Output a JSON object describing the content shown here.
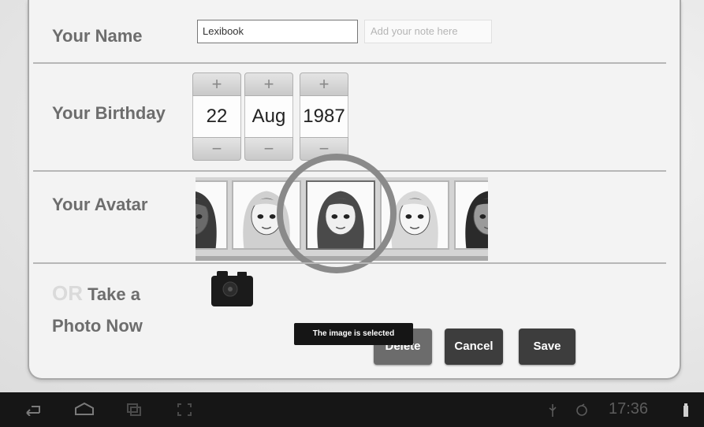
{
  "form": {
    "name_label": "Your Name",
    "name_value": "Lexibook",
    "note_placeholder": "Add your note here",
    "birthday_label": "Your Birthday",
    "birthday": {
      "day": "22",
      "month": "Aug",
      "year": "1987",
      "plus_glyph": "+",
      "minus_glyph": "−"
    },
    "avatar_label": "Your Avatar",
    "avatars": [
      {
        "name": "avatar-1",
        "hair": "#3a3a3a",
        "face": "#6a6a6a"
      },
      {
        "name": "avatar-2",
        "hair": "#d0d0d0",
        "face": "#f2f2f2"
      },
      {
        "name": "avatar-3",
        "hair": "#4a4a4a",
        "face": "#efefef"
      },
      {
        "name": "avatar-4",
        "hair": "#d8d8d8",
        "face": "#f6f6f6"
      },
      {
        "name": "avatar-5",
        "hair": "#2a2a2a",
        "face": "#9a9a9a"
      }
    ],
    "selected_avatar": 2,
    "photo_or": "OR",
    "photo_label_line1": "Take a",
    "photo_label_line2": "Photo Now",
    "camera_icon": "camera-icon"
  },
  "actions": {
    "delete_label": "Delete",
    "cancel_label": "Cancel",
    "save_label": "Save"
  },
  "toast": "The image is selected",
  "status_bar": {
    "time": "17:36",
    "icons": [
      "back-icon",
      "home-icon",
      "recent-apps-icon",
      "screenshot-icon",
      "usb-icon",
      "sync-icon",
      "battery-icon"
    ]
  },
  "colors": {
    "button_bg": "#3d3d3d",
    "navbar_bg": "#161616",
    "highlight_ring": "#8a8a8a"
  }
}
